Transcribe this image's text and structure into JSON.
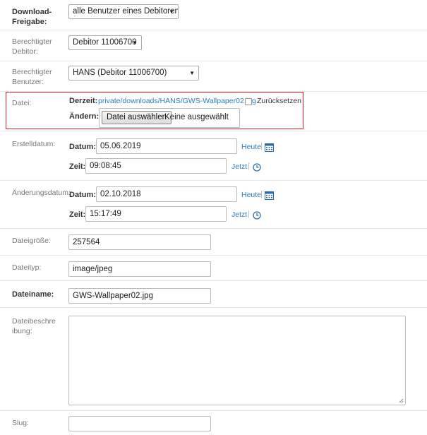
{
  "download_freigabe": {
    "label": "Download-Freigabe:",
    "value": "alle Benutzer eines Debitoren"
  },
  "berechtigter_debitor": {
    "label": "Berechtigter Debitor:",
    "value": "Debitor 11006700"
  },
  "berechtigter_benutzer": {
    "label": "Berechtigter Benutzer:",
    "value": "HANS (Debitor 11006700)"
  },
  "datei": {
    "label": "Datei:",
    "derzeit_label": "Derzeit:",
    "derzeit_link": "private/downloads/HANS/GWS-Wallpaper02.jpg",
    "zuruecksetzen_label": "Zurücksetzen",
    "aendern_label": "Ändern:",
    "choose_button": "Datei auswählen",
    "none_selected": "Keine ausgewählt"
  },
  "erstelldatum": {
    "label": "Erstelldatum:",
    "datum_label": "Datum:",
    "datum_value": "05.06.2019",
    "heute_link": "Heute",
    "zeit_label": "Zeit:",
    "zeit_value": "09:08:45",
    "jetzt_link": "Jetzt"
  },
  "aenderungsdatum": {
    "label": "Änderungsdatum:",
    "datum_label": "Datum:",
    "datum_value": "02.10.2018",
    "heute_link": "Heute",
    "zeit_label": "Zeit:",
    "zeit_value": "15:17:49",
    "jetzt_link": "Jetzt"
  },
  "dateigroesse": {
    "label": "Dateigröße:",
    "value": "257564"
  },
  "dateityp": {
    "label": "Dateityp:",
    "value": "image/jpeg"
  },
  "dateiname": {
    "label": "Dateiname:",
    "value": "GWS-Wallpaper02.jpg"
  },
  "dateibeschreibung": {
    "label": "Dateibeschreibung:",
    "value": ""
  },
  "slug": {
    "label": "Slug:",
    "value": ""
  },
  "separator": "|",
  "colors": {
    "link": "#2a7dc0",
    "highlight": "#e02020"
  }
}
